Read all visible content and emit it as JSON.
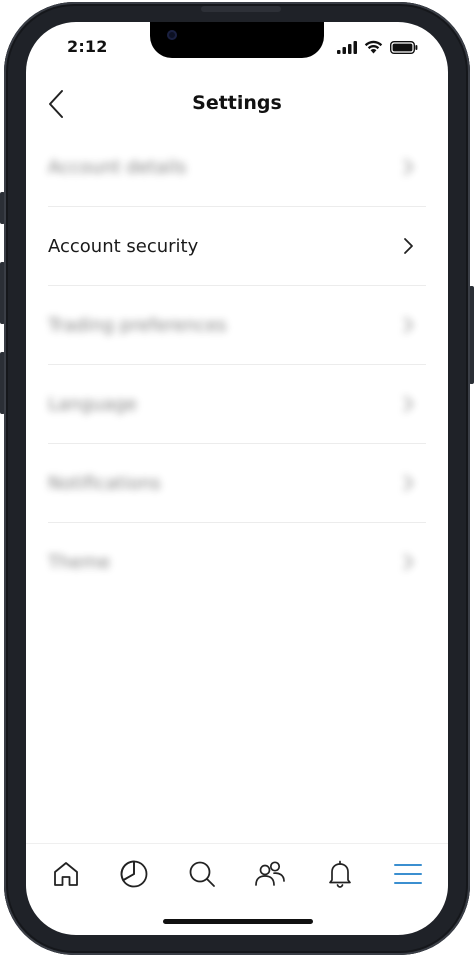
{
  "status_bar": {
    "time": "2:12",
    "icons": [
      "signal-icon",
      "wifi-icon",
      "battery-icon"
    ]
  },
  "header": {
    "title": "Settings",
    "back_icon": "chevron-left-icon"
  },
  "menu": {
    "items": [
      {
        "label": "Account details",
        "blurred": true
      },
      {
        "label": "Account security",
        "blurred": false
      },
      {
        "label": "Trading preferences",
        "blurred": true
      },
      {
        "label": "Language",
        "blurred": true
      },
      {
        "label": "Notifications",
        "blurred": true
      },
      {
        "label": "Theme",
        "blurred": true
      }
    ]
  },
  "tabbar": {
    "tabs": [
      {
        "name": "home",
        "icon": "home-icon"
      },
      {
        "name": "portfolio",
        "icon": "pie-chart-icon"
      },
      {
        "name": "search",
        "icon": "search-icon"
      },
      {
        "name": "community",
        "icon": "people-icon"
      },
      {
        "name": "notifications",
        "icon": "bell-icon"
      },
      {
        "name": "menu",
        "icon": "hamburger-icon",
        "active": true
      }
    ]
  },
  "colors": {
    "active_tab": "#3b8fd0",
    "text": "#1a1a1a",
    "divider": "#ececec",
    "frame": "#1f2228"
  }
}
